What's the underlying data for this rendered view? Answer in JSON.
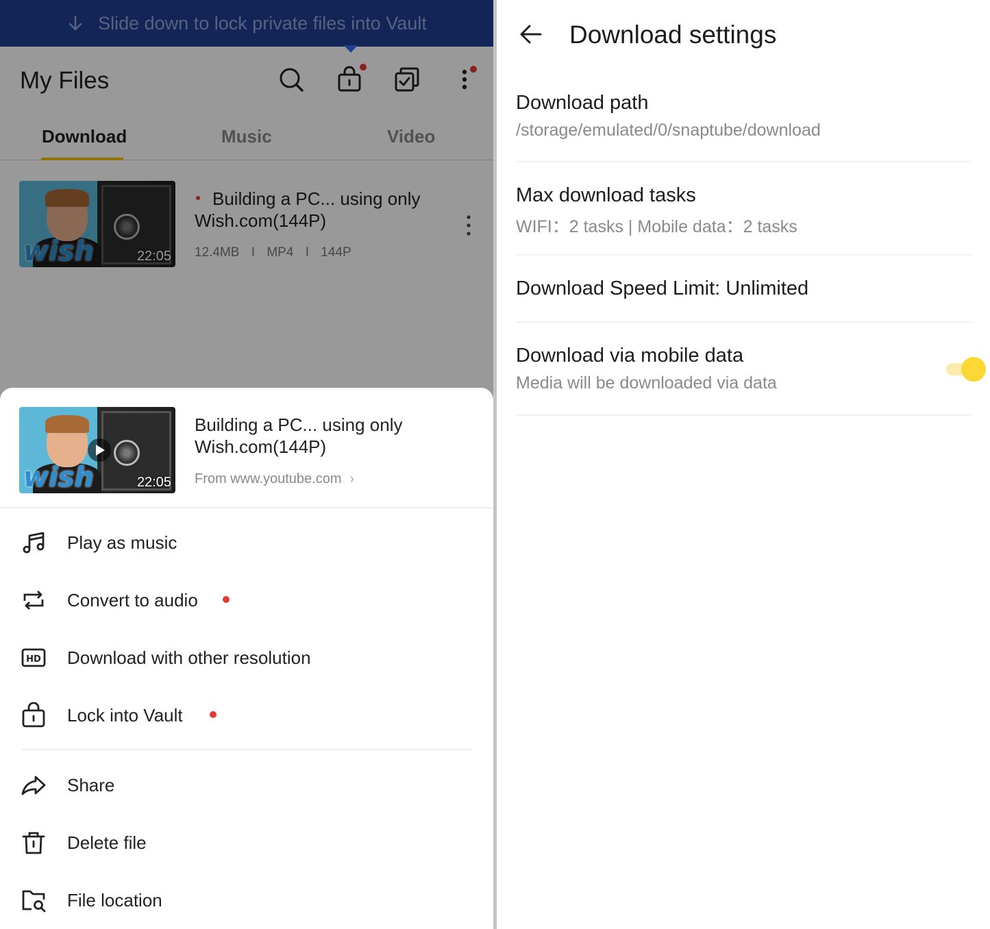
{
  "left": {
    "banner": {
      "text": "Slide down to lock private files into Vault"
    },
    "toolbar": {
      "title": "My Files"
    },
    "tabs": [
      {
        "label": "Download",
        "active": true
      },
      {
        "label": "Music",
        "active": false
      },
      {
        "label": "Video",
        "active": false
      }
    ],
    "file": {
      "title": "Building a PC... using only Wish.com(144P)",
      "duration": "22:05",
      "size": "12.4MB",
      "format": "MP4",
      "resolution": "144P",
      "thumbnail_text": "wish"
    },
    "sheet": {
      "title": "Building a PC... using only Wish.com(144P)",
      "duration": "22:05",
      "source": "From www.youtube.com",
      "menu": [
        {
          "label": "Play as music",
          "icon": "music-note-icon",
          "badge": false
        },
        {
          "label": "Convert to audio",
          "icon": "convert-icon",
          "badge": true
        },
        {
          "label": "Download with other resolution",
          "icon": "hd-icon",
          "badge": false
        },
        {
          "label": "Lock into Vault",
          "icon": "lock-icon",
          "badge": true
        },
        {
          "label": "Share",
          "icon": "share-icon",
          "badge": false
        },
        {
          "label": "Delete file",
          "icon": "trash-icon",
          "badge": false
        },
        {
          "label": "File location",
          "icon": "folder-search-icon",
          "badge": false
        }
      ]
    },
    "colors": {
      "banner": "#213f8f",
      "accent": "#f2c200",
      "badge": "#e53935"
    }
  },
  "right": {
    "title": "Download settings",
    "settings": [
      {
        "title": "Download path",
        "subtitle": "/storage/emulated/0/snaptube/download"
      },
      {
        "title": "Max download tasks",
        "subtitle": "WIFI：2 tasks | Mobile data：2 tasks"
      },
      {
        "title": "Download Speed Limit: Unlimited"
      },
      {
        "title": "Download via mobile data",
        "subtitle": "Media will be downloaded via data",
        "toggle_on": true
      }
    ],
    "colors": {
      "toggle": "#fdd835"
    }
  }
}
